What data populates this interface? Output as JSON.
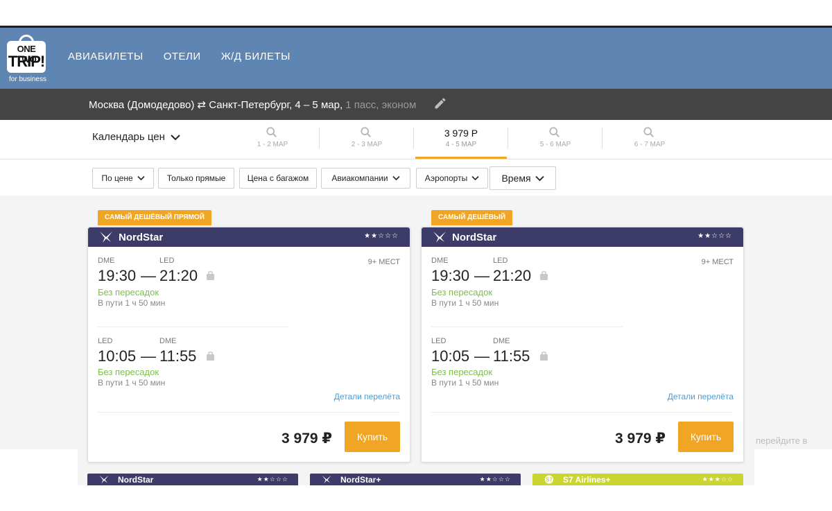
{
  "logo": {
    "line1": "ONE TWO",
    "line2": "TRIP!",
    "line3": "for business"
  },
  "nav": {
    "flights": "АВИАБИЛЕТЫ",
    "hotels": "ОТЕЛИ",
    "trains": "Ж/Д БИЛЕТЫ"
  },
  "search": {
    "route": "Москва (Домодедово) ⇄ Санкт-Петербург, 4 – 5 мар,",
    "pax": "1 пасс, эконом"
  },
  "calendar": {
    "label": "Календарь цен",
    "days": [
      {
        "date": "1 - 2 МАР",
        "price": ""
      },
      {
        "date": "2 - 3 МАР",
        "price": ""
      },
      {
        "date": "4 - 5 МАР",
        "price": "3 979 Р"
      },
      {
        "date": "5 - 6 МАР",
        "price": ""
      },
      {
        "date": "6 - 7 МАР",
        "price": ""
      }
    ]
  },
  "filters": {
    "by_price": "По цене",
    "direct_only": "Только прямые",
    "with_baggage": "Цена с багажом",
    "airlines": "Авиакомпании",
    "airports": "Аэропорты",
    "time": "Время"
  },
  "cards": [
    {
      "badge": "САМЫЙ ДЕШЁВЫЙ ПРЯМОЙ",
      "airline": "NordStar",
      "stars": "★★☆☆☆",
      "seats": "9+ МЕСТ",
      "outbound": {
        "from": "DME",
        "to": "LED",
        "dep": "19:30",
        "dash": "—",
        "arr": "21:20",
        "stops": "Без пересадок",
        "duration": "В пути 1 ч 50 мин"
      },
      "inbound": {
        "from": "LED",
        "to": "DME",
        "dep": "10:05",
        "dash": "—",
        "arr": "11:55",
        "stops": "Без пересадок",
        "duration": "В пути 1 ч 50 мин"
      },
      "details": "Детали перелёта",
      "price": "3 979 ₽",
      "buy": "Купить"
    },
    {
      "badge": "САМЫЙ ДЕШЁВЫЙ",
      "airline": "NordStar",
      "stars": "★★☆☆☆",
      "seats": "9+ МЕСТ",
      "outbound": {
        "from": "DME",
        "to": "LED",
        "dep": "19:30",
        "dash": "—",
        "arr": "21:20",
        "stops": "Без пересадок",
        "duration": "В пути 1 ч 50 мин"
      },
      "inbound": {
        "from": "LED",
        "to": "DME",
        "dep": "10:05",
        "dash": "—",
        "arr": "11:55",
        "stops": "Без пересадок",
        "duration": "В пути 1 ч 50 мин"
      },
      "details": "Детали перелёта",
      "price": "3 979 ₽",
      "buy": "Купить"
    }
  ],
  "hint": "перейдите в",
  "more_results": [
    {
      "airline": "NordStar",
      "stars": "★★☆☆☆"
    },
    {
      "airline": "NordStar+",
      "stars": "★★☆☆☆"
    },
    {
      "airline": "S7 Airlines+",
      "stars": "★★★☆☆"
    }
  ],
  "colors": {
    "header": "#5f86b2",
    "searchbar": "#444444",
    "accent": "#f0a524",
    "card_head": "#3d3c68",
    "nonstop": "#7ac04a",
    "link": "#4b9cd6",
    "s7": "#c8d62f"
  }
}
